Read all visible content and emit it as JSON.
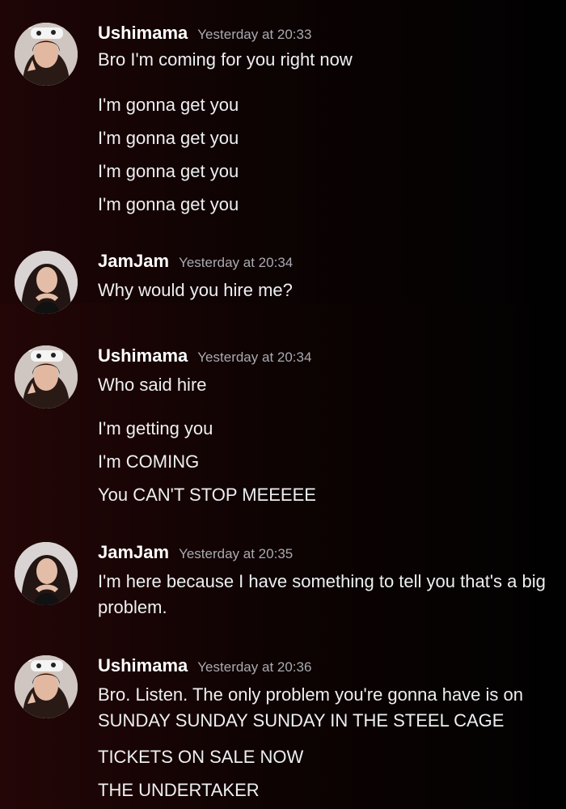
{
  "messages": [
    {
      "author": "Ushimama",
      "timestamp": "Yesterday at 20:33",
      "lines": [
        "Bro I'm coming for you right now",
        "I'm gonna get you",
        "I'm gonna get you",
        "I'm gonna get you",
        "I'm gonna get you"
      ]
    },
    {
      "author": "JamJam",
      "timestamp": "Yesterday at 20:34",
      "lines": [
        "Why would you hire me?"
      ]
    },
    {
      "author": "Ushimama",
      "timestamp": "Yesterday at 20:34",
      "lines": [
        "Who said hire",
        "I'm getting you",
        "I'm COMING",
        "You CAN'T STOP MEEEEE"
      ]
    },
    {
      "author": "JamJam",
      "timestamp": "Yesterday at 20:35",
      "lines": [
        "I'm here because I have something to tell you that's a big problem."
      ]
    },
    {
      "author": "Ushimama",
      "timestamp": "Yesterday at 20:36",
      "lines": [
        "Bro. Listen. The only problem you're gonna have is on SUNDAY SUNDAY SUNDAY IN THE STEEL CAGE",
        "TICKETS ON SALE NOW",
        "THE UNDERTAKER"
      ]
    }
  ]
}
